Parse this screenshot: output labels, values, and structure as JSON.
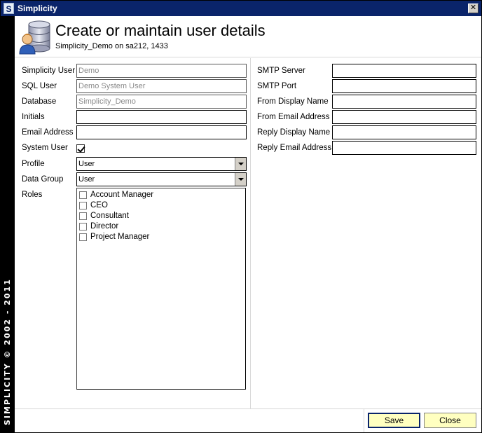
{
  "window": {
    "title": "Simplicity",
    "app_icon_letter": "S",
    "close_glyph": "✕"
  },
  "sidebar": {
    "vertical_text": "SIMPLICITY © 2002 - 2011"
  },
  "header": {
    "icon": "database-user-icon",
    "title": "Create or maintain user details",
    "subtitle": "Simplicity_Demo on sa212, 1433"
  },
  "left_form": {
    "simplicity_user": {
      "label": "Simplicity User",
      "value": "Demo"
    },
    "sql_user": {
      "label": "SQL User",
      "value": "Demo System User"
    },
    "database": {
      "label": "Database",
      "value": "Simplicity_Demo"
    },
    "initials": {
      "label": "Initials",
      "value": ""
    },
    "email_address": {
      "label": "Email Address",
      "value": ""
    },
    "system_user": {
      "label": "System User",
      "checked": true
    },
    "profile": {
      "label": "Profile",
      "value": "User"
    },
    "data_group": {
      "label": "Data Group",
      "value": "User"
    },
    "roles": {
      "label": "Roles",
      "items": [
        {
          "label": "Account Manager",
          "checked": false
        },
        {
          "label": "CEO",
          "checked": false
        },
        {
          "label": "Consultant",
          "checked": false
        },
        {
          "label": "Director",
          "checked": false
        },
        {
          "label": "Project Manager",
          "checked": false
        }
      ]
    }
  },
  "right_form": {
    "smtp_server": {
      "label": "SMTP Server",
      "value": ""
    },
    "smtp_port": {
      "label": "SMTP Port",
      "value": ""
    },
    "from_display_name": {
      "label": "From Display Name",
      "value": ""
    },
    "from_email_address": {
      "label": "From Email Address",
      "value": ""
    },
    "reply_display_name": {
      "label": "Reply Display Name",
      "value": ""
    },
    "reply_email_address": {
      "label": "Reply Email Address",
      "value": ""
    }
  },
  "footer": {
    "save_label": "Save",
    "close_label": "Close"
  },
  "colors": {
    "titlebar": "#0a246a",
    "sidebar": "#000000",
    "button_fill": "#ffffc0",
    "readonly_text": "#8a8a8a"
  }
}
